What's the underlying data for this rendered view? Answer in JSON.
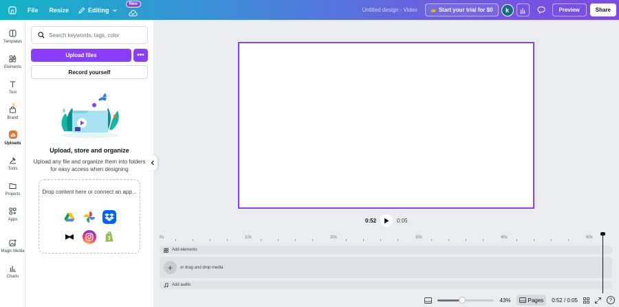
{
  "topbar": {
    "file_label": "File",
    "resize_label": "Resize",
    "editing_label": "Editing",
    "new_badge": "New",
    "doc_title": "Untitled design - Video",
    "trial_label": "Start your trial for $0",
    "avatar_initial": "k",
    "preview_label": "Preview",
    "share_label": "Share"
  },
  "rail": {
    "items": [
      {
        "label": "Templates",
        "icon": "templates-icon"
      },
      {
        "label": "Elements",
        "icon": "elements-icon"
      },
      {
        "label": "Text",
        "icon": "text-icon"
      },
      {
        "label": "Brand",
        "icon": "brand-icon"
      },
      {
        "label": "Uploads",
        "icon": "uploads-icon"
      },
      {
        "label": "Tools",
        "icon": "tools-icon"
      },
      {
        "label": "Projects",
        "icon": "projects-icon"
      },
      {
        "label": "Apps",
        "icon": "apps-icon"
      },
      {
        "label": "Magic Media",
        "icon": "magic-media-icon"
      },
      {
        "label": "Charts",
        "icon": "charts-icon"
      }
    ]
  },
  "panel": {
    "search_placeholder": "Search keywords, tags, color",
    "upload_label": "Upload files",
    "more_label": "•••",
    "record_label": "Record yourself",
    "heading": "Upload, store and organize",
    "description": "Upload any file and organize them into folders for easy access when designing",
    "dropzone_text": "Drop content here or connect an app...",
    "apps": [
      "google-drive",
      "google-photos",
      "dropbox",
      "capcut",
      "instagram",
      "shopify"
    ]
  },
  "player": {
    "current": "0:52",
    "total": "0:05"
  },
  "timeline": {
    "ticks": [
      "0s",
      "10s",
      "20s",
      "30s",
      "40s",
      "50s"
    ],
    "add_elements": "Add elements",
    "drop_media": "or drag and drop media",
    "add_audio": "Add audio"
  },
  "footer": {
    "zoom_label": "43%",
    "zoom_value": 0.43,
    "pages_label": "Pages",
    "time_label": "0:52 / 0:05",
    "help_label": "?"
  },
  "colors": {
    "accent": "#8b3dff",
    "gradient_start": "#12b3c6",
    "gradient_end": "#7d4be6"
  }
}
